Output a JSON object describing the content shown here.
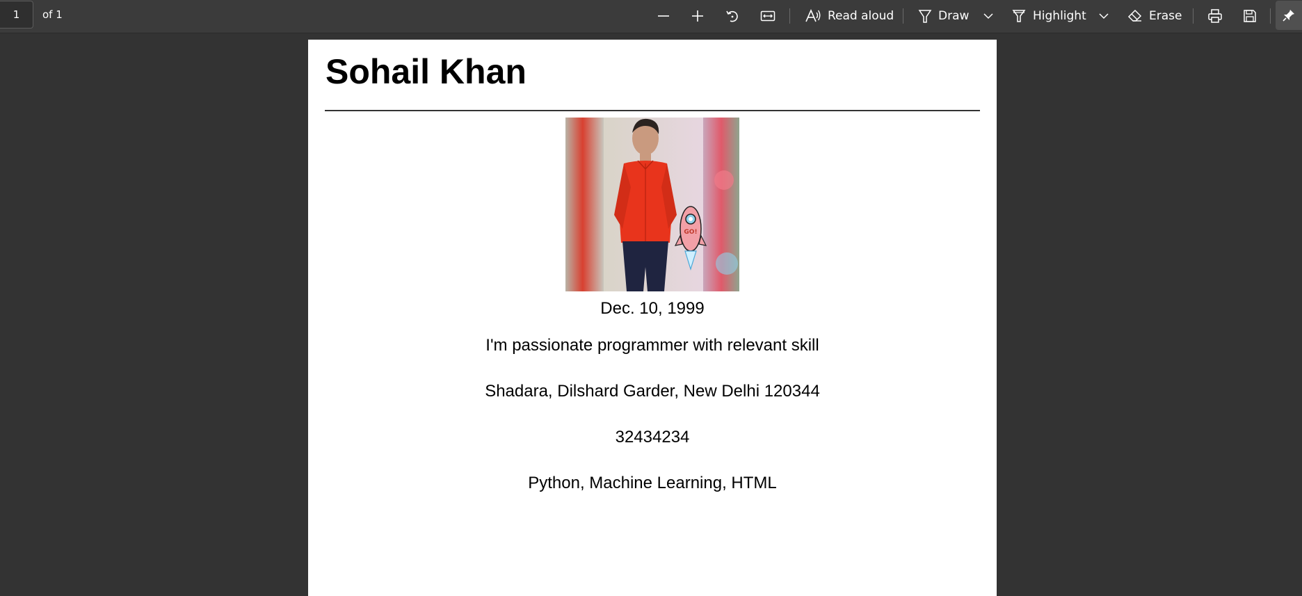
{
  "toolbar": {
    "page_number": "1",
    "page_of": "of 1",
    "read_aloud_label": "Read aloud",
    "draw_label": "Draw",
    "highlight_label": "Highlight",
    "erase_label": "Erase",
    "icons": [
      "zoom-out-icon",
      "zoom-in-icon",
      "rotate-icon",
      "fit-width-icon",
      "read-aloud-icon",
      "draw-icon",
      "chevron-down-icon",
      "highlight-icon",
      "eraser-icon",
      "print-icon",
      "save-icon",
      "pin-icon"
    ]
  },
  "document": {
    "name": "Sohail Khan",
    "dob": "Dec. 10, 1999",
    "bio": "I'm passionate programmer with relevant skill",
    "address": "Shadara, Dilshard Garder, New Delhi 120344",
    "phone": "32434234",
    "skills": "Python, Machine Learning, HTML"
  },
  "colors": {
    "toolbar_bg": "#3b3b3b",
    "viewer_bg": "#333333",
    "page_bg": "#ffffff",
    "shirt": "#e8341c"
  }
}
